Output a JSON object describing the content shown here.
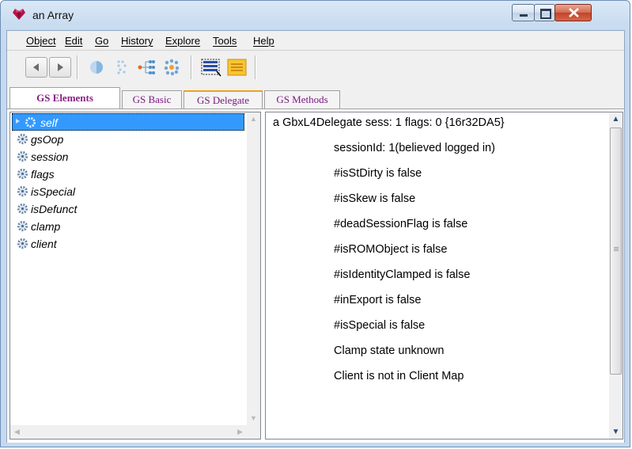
{
  "window": {
    "title": "an Array",
    "app_icon": "heart-gem-icon"
  },
  "menu": [
    "Object",
    "Edit",
    "Go",
    "History",
    "Explore",
    "Tools",
    "Help"
  ],
  "toolbar": {
    "icons": [
      "back-arrow-icon",
      "forward-arrow-icon",
      "half-circle-icon",
      "dotted-grid-icon",
      "hierarchy-icon",
      "cluster-icon",
      "list-select-icon",
      "notes-icon"
    ]
  },
  "tabs": [
    {
      "label": "GS Elements",
      "active": true
    },
    {
      "label": "GS Basic",
      "active": false
    },
    {
      "label": "GS Delegate",
      "active": false
    },
    {
      "label": "GS Methods",
      "active": false
    }
  ],
  "elements": [
    {
      "label": "self",
      "selected": true
    },
    {
      "label": "gsOop",
      "selected": false
    },
    {
      "label": "session",
      "selected": false
    },
    {
      "label": "flags",
      "selected": false
    },
    {
      "label": "isSpecial",
      "selected": false
    },
    {
      "label": "isDefunct",
      "selected": false
    },
    {
      "label": "clamp",
      "selected": false
    },
    {
      "label": "client",
      "selected": false
    }
  ],
  "detail": {
    "header": "a GbxL4Delegate sess: 1 flags: 0 {16r32DA5}",
    "lines": [
      "sessionId: 1(believed logged in)",
      "#isStDirty is false",
      "#isSkew is false",
      "#deadSessionFlag is false",
      "#isROMObject is false",
      "#isIdentityClamped is false",
      "#inExport is false",
      "#isSpecial is false",
      "Clamp state unknown",
      "Client is not in Client Map"
    ]
  },
  "colors": {
    "selection": "#3399ff",
    "tab_text": "#7b1a82",
    "accent_tab": "#f0a020"
  }
}
